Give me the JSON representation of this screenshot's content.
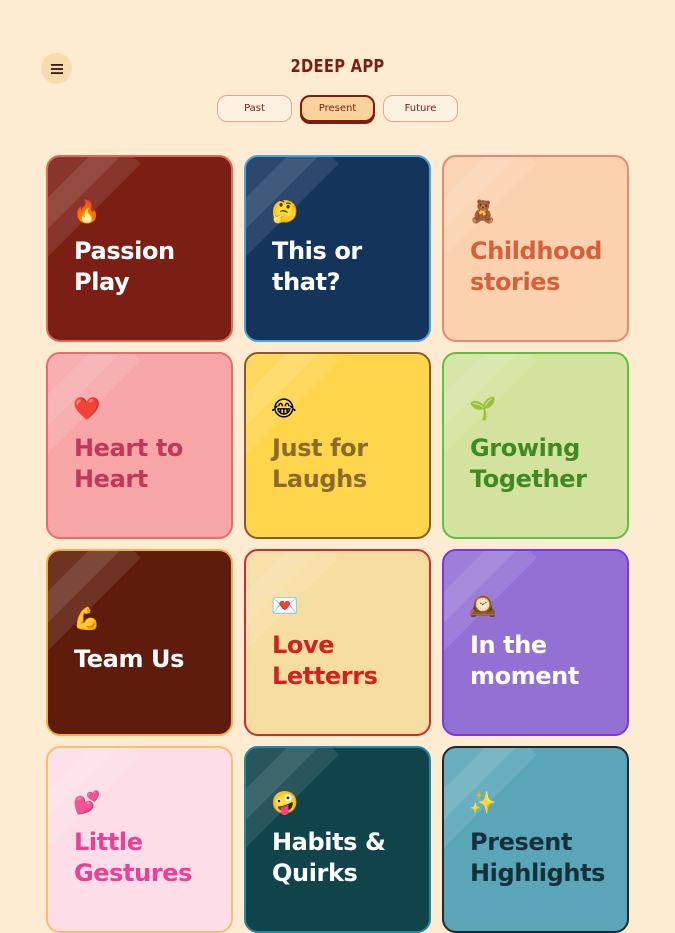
{
  "header": {
    "menu_icon": "hamburger-menu-icon",
    "title": "2DEEP APP"
  },
  "tabs": [
    {
      "label": "Past",
      "active": false
    },
    {
      "label": "Present",
      "active": true
    },
    {
      "label": "Future",
      "active": false
    }
  ],
  "cards": [
    {
      "icon": "🔥",
      "icon_name": "fire-icon",
      "label_lines": [
        "Passion",
        "Play"
      ],
      "bg": "#7b1f15",
      "border": "#e06a55",
      "color": "#ffffff"
    },
    {
      "icon": "🤔",
      "icon_name": "thinking-face-icon",
      "label_lines": [
        "This or",
        "that?"
      ],
      "bg": "#15345c",
      "border": "#4aa4e0",
      "color": "#ffffff"
    },
    {
      "icon": "🧸",
      "icon_name": "teddy-bear-icon",
      "label_lines": [
        "Childhood",
        "stories"
      ],
      "bg": "#fcd1ad",
      "border": "#ea8770",
      "color": "#d5603c"
    },
    {
      "icon": "❤️",
      "icon_name": "red-heart-icon",
      "label_lines": [
        "Heart to",
        "Heart"
      ],
      "bg": "#f7a6a8",
      "border": "#e96b6f",
      "color": "#c4375a"
    },
    {
      "icon": "😂",
      "icon_name": "laughing-face-icon",
      "label_lines": [
        "Just for",
        "Laughs"
      ],
      "bg": "#ffd54b",
      "border": "#8e5a24",
      "color": "#8b6a2c"
    },
    {
      "icon": "🌱",
      "icon_name": "seedling-icon",
      "label_lines": [
        "Growing",
        "Together"
      ],
      "bg": "#d3e39e",
      "border": "#5cc23e",
      "color": "#3f8a25"
    },
    {
      "icon": "💪",
      "icon_name": "flexed-biceps-icon",
      "label_lines": [
        "Team Us"
      ],
      "bg": "#5f1c0d",
      "border": "#f2b140",
      "color": "#ffffff"
    },
    {
      "icon": "💌",
      "icon_name": "love-letter-icon",
      "label_lines": [
        "Love",
        "Letterrs"
      ],
      "bg": "#f6dda0",
      "border": "#d42b2b",
      "color": "#d42020"
    },
    {
      "icon": "🕰️",
      "icon_name": "mantelpiece-clock-icon",
      "label_lines": [
        "In the",
        "moment"
      ],
      "bg": "#9270d4",
      "border": "#7a36e8",
      "color": "#ffffff"
    },
    {
      "icon": "💕",
      "icon_name": "two-hearts-icon",
      "label_lines": [
        "Little",
        "Gestures"
      ],
      "bg": "#fcdde8",
      "border": "#f5c074",
      "color": "#ec3f95"
    },
    {
      "icon": "🤪",
      "icon_name": "zany-face-icon",
      "label_lines": [
        "Habits &",
        "Quirks"
      ],
      "bg": "#11434b",
      "border": "#1f8aa8",
      "color": "#ffffff"
    },
    {
      "icon": "✨",
      "icon_name": "sparkles-icon",
      "label_lines": [
        "Present",
        "Highlights"
      ],
      "bg": "#5aa6b8",
      "border": "#1d2a33",
      "color": "#15303a"
    }
  ]
}
